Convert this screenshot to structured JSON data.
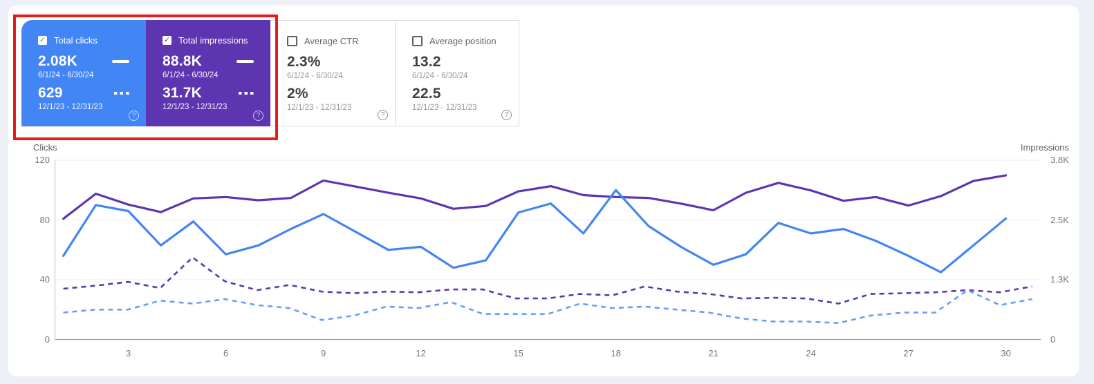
{
  "colors": {
    "page_background": "#edf0f6",
    "panel_background": "#ffffff",
    "clicks_blue": "#4285f4",
    "impressions_purple": "#5e35b1",
    "annotation_red": "#e81b17"
  },
  "icons": {
    "check": "✓",
    "help": "?"
  },
  "scorecards": [
    {
      "id": "total-clicks",
      "label": "Total clicks",
      "checked": true,
      "color": "#4285f4",
      "current": {
        "value": "2.08K",
        "range": "6/1/24 - 6/30/24"
      },
      "previous": {
        "value": "629",
        "range": "12/1/23 - 12/31/23"
      }
    },
    {
      "id": "total-impressions",
      "label": "Total impressions",
      "checked": true,
      "color": "#5e35b1",
      "current": {
        "value": "88.8K",
        "range": "6/1/24 - 6/30/24"
      },
      "previous": {
        "value": "31.7K",
        "range": "12/1/23 - 12/31/23"
      }
    },
    {
      "id": "average-ctr",
      "label": "Average CTR",
      "checked": false,
      "color": "#ffffff",
      "current": {
        "value": "2.3%",
        "range": "6/1/24 - 6/30/24"
      },
      "previous": {
        "value": "2%",
        "range": "12/1/23 - 12/31/23"
      }
    },
    {
      "id": "average-position",
      "label": "Average position",
      "checked": false,
      "color": "#ffffff",
      "current": {
        "value": "13.2",
        "range": "6/1/24 - 6/30/24"
      },
      "previous": {
        "value": "22.5",
        "range": "12/1/23 - 12/31/23"
      }
    }
  ],
  "chart_data": {
    "type": "line",
    "left_axis": {
      "title": "Clicks",
      "max": 120,
      "ticks": [
        {
          "label": "0",
          "value": 0
        },
        {
          "label": "40",
          "value": 40
        },
        {
          "label": "80",
          "value": 80
        },
        {
          "label": "120",
          "value": 120
        }
      ]
    },
    "right_axis": {
      "title": "Impressions",
      "max": 3800,
      "ticks": [
        {
          "label": "0",
          "value": 0
        },
        {
          "label": "1.3K",
          "value": 1267
        },
        {
          "label": "2.5K",
          "value": 2533
        },
        {
          "label": "3.8K",
          "value": 3800
        }
      ]
    },
    "x_ticks": [
      {
        "label": "3",
        "day": 3
      },
      {
        "label": "6",
        "day": 6
      },
      {
        "label": "9",
        "day": 9
      },
      {
        "label": "12",
        "day": 12
      },
      {
        "label": "15",
        "day": 15
      },
      {
        "label": "18",
        "day": 18
      },
      {
        "label": "21",
        "day": 21
      },
      {
        "label": "24",
        "day": 24
      },
      {
        "label": "27",
        "day": 27
      },
      {
        "label": "30",
        "day": 30
      }
    ],
    "grid": true,
    "legend_position": "none",
    "series": [
      {
        "name": "Impressions (previous)",
        "period": "12/1/23 - 12/31/23",
        "style": "dashed",
        "axis": "right",
        "color": "#5e35b1",
        "values": [
          1075,
          1140,
          1220,
          1090,
          1740,
          1235,
          1045,
          1155,
          1015,
          980,
          1015,
          1000,
          1060,
          1060,
          870,
          870,
          965,
          935,
          1125,
          1015,
          965,
          870,
          885,
          870,
          760,
          965,
          980,
          1000,
          1045,
          1000,
          1125
        ]
      },
      {
        "name": "Clicks (previous)",
        "period": "12/1/23 - 12/31/23",
        "style": "dashed",
        "axis": "left",
        "color": "#64a0f7",
        "values": [
          18,
          20,
          20,
          26,
          24,
          27,
          23,
          21,
          13,
          16,
          22,
          21,
          25,
          17,
          17,
          17,
          24,
          21,
          22,
          20,
          18,
          14,
          12,
          12,
          11,
          16,
          18,
          18,
          33,
          23,
          27
        ]
      },
      {
        "name": "Impressions (current)",
        "period": "6/1/24 - 6/30/24",
        "style": "solid",
        "axis": "right",
        "color": "#5e35b1",
        "values": [
          2560,
          3090,
          2860,
          2700,
          2990,
          3020,
          2950,
          3000,
          3370,
          3240,
          3110,
          2990,
          2770,
          2830,
          3140,
          3250,
          3060,
          3020,
          3000,
          2880,
          2740,
          3110,
          3320,
          3160,
          2940,
          3020,
          2840,
          3040,
          3360,
          3480
        ]
      },
      {
        "name": "Clicks (current)",
        "period": "6/1/24 - 6/30/24",
        "style": "solid",
        "axis": "left",
        "color": "#4285f4",
        "values": [
          56,
          90,
          86,
          63,
          79,
          57,
          63,
          74,
          84,
          72,
          60,
          62,
          48,
          53,
          85,
          91,
          71,
          100,
          76,
          62,
          50,
          57,
          78,
          71,
          74,
          66,
          56,
          45,
          63,
          81
        ]
      }
    ]
  }
}
